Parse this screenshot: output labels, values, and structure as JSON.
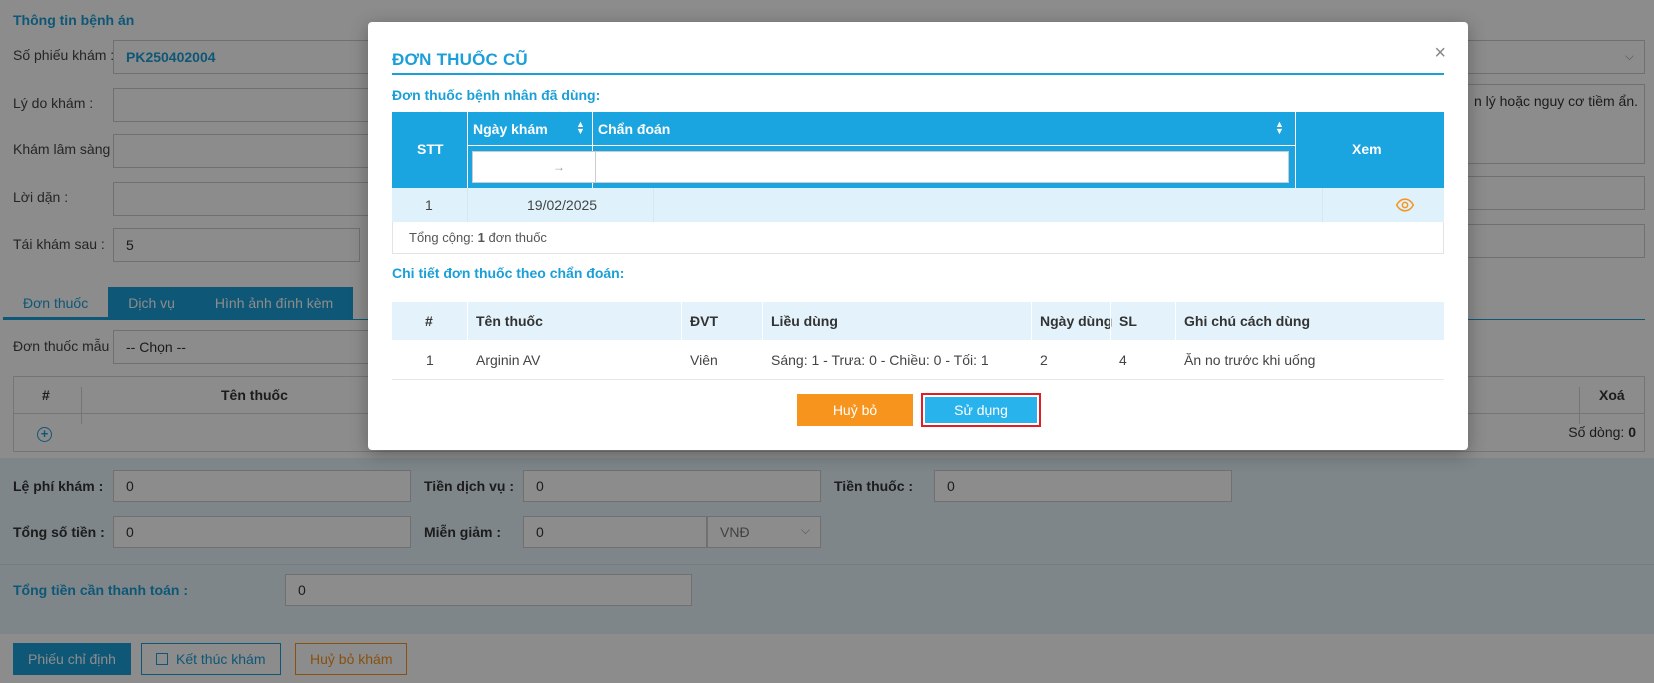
{
  "background": {
    "section_title": "Thông tin bệnh án",
    "fields": {
      "so_phieu_label": "Số phiếu khám :",
      "so_phieu_value": "PK250402004",
      "ly_do_label": "Lý do khám :",
      "kham_ls_label": "Khám lâm sàng :",
      "loi_dan_label": "Lời dặn :",
      "tai_kham_label": "Tái khám sau :",
      "tai_kham_value": "5"
    },
    "right_area_text": "n lý hoặc nguy cơ tiềm ẩn.",
    "tabs": [
      "Đơn thuốc",
      "Dịch vụ",
      "Hình ảnh đính kèm"
    ],
    "don_thuoc_mau_label": "Đơn thuốc mẫu :",
    "don_thuoc_mau_value": "-- Chọn --",
    "grid": {
      "col_index": "#",
      "col_name": "Tên thuốc",
      "col_delete": "Xoá",
      "row_count_label": "Số dòng:",
      "row_count": "0"
    },
    "fees": {
      "le_phi_label": "Lệ phí khám :",
      "le_phi_value": "0",
      "tien_dv_label": "Tiền dịch vụ :",
      "tien_dv_value": "0",
      "tien_thuoc_label": "Tiền thuốc :",
      "tien_thuoc_value": "0",
      "tong_so_label": "Tổng số tiền :",
      "tong_so_value": "0",
      "mien_giam_label": "Miễn giảm :",
      "mien_giam_value": "0",
      "currency": "VNĐ",
      "tong_tt_label": "Tổng tiền cần thanh toán :",
      "tong_tt_value": "0"
    },
    "buttons": {
      "phieu_chi_dinh": "Phiếu chỉ định",
      "ket_thuc": "Kết thúc khám",
      "huy_bo_kham": "Huỷ bỏ khám"
    }
  },
  "modal": {
    "title": "ĐƠN THUỐC CŨ",
    "close_glyph": "×",
    "history_title": "Đơn thuốc bệnh nhân đã dùng:",
    "history_table": {
      "col_stt": "STT",
      "col_date": "Ngày khám",
      "col_diag": "Chẩn đoán",
      "col_view": "Xem",
      "date_sep": "→",
      "rows": [
        {
          "stt": "1",
          "date": "19/02/2025",
          "diag": ""
        }
      ],
      "footer_prefix": "Tổng cộng:",
      "footer_count": "1",
      "footer_suffix": "đơn thuốc"
    },
    "detail_title": "Chi tiết đơn thuốc theo chẩn đoán:",
    "detail_table": {
      "headers": {
        "idx": "#",
        "name": "Tên thuốc",
        "unit": "ĐVT",
        "dose": "Liều dùng",
        "days": "Ngày dùng",
        "qty": "SL",
        "note": "Ghi chú cách dùng"
      },
      "rows": [
        {
          "idx": "1",
          "name": "Arginin AV",
          "unit": "Viên",
          "dose": "Sáng: 1 - Trưa: 0 - Chiều: 0 - Tối: 1",
          "days": "2",
          "qty": "4",
          "note": "Ăn no trước khi uống"
        }
      ]
    },
    "btn_cancel": "Huỷ bỏ",
    "btn_use": "Sử dụng"
  },
  "colors": {
    "accent": "#1a9fd8",
    "orange": "#f7941d",
    "highlight": "#e01e25"
  }
}
